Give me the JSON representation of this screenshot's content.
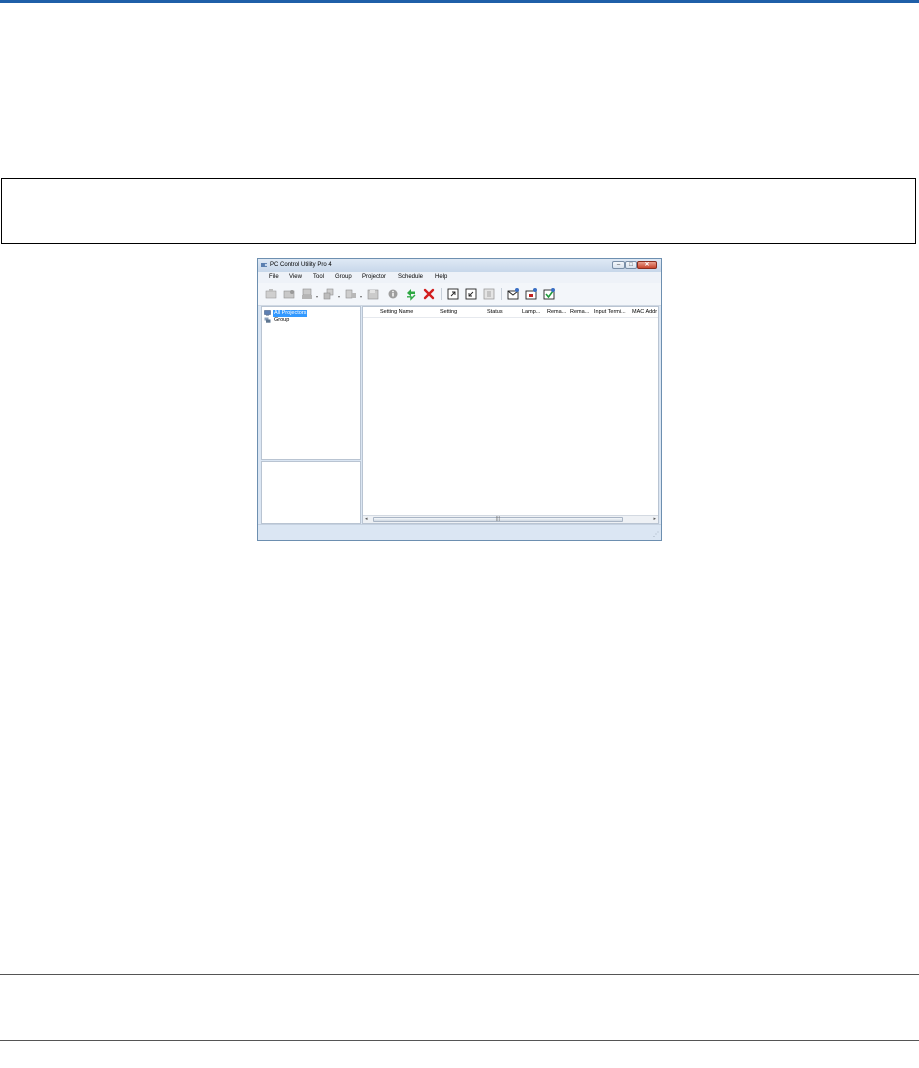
{
  "window": {
    "title": "PC Control Utility Pro 4",
    "controls": {
      "minimize": "–",
      "maximize": "□",
      "close": "✕"
    }
  },
  "menu": {
    "items": [
      "File",
      "View",
      "Tool",
      "Group",
      "Projector",
      "Schedule",
      "Help"
    ]
  },
  "toolbar": {
    "icons": [
      "monitor-icon",
      "folder-icon",
      "projector-icon",
      "group-icon",
      "network-icon",
      "save-icon",
      "info-icon",
      "refresh-icon",
      "delete-icon",
      "export-icon",
      "import-icon",
      "page-icon",
      "mail-icon",
      "calendar-icon",
      "check-icon"
    ]
  },
  "tree": {
    "items": [
      {
        "label": "All Projectors",
        "selected": true
      },
      {
        "label": "Group",
        "selected": false
      }
    ]
  },
  "table": {
    "columns": [
      "Setting Name",
      "Setting",
      "Status",
      "Lamp...",
      "Rema...",
      "Rema...",
      "Input Termi...",
      "MAC Addr"
    ]
  },
  "scrollbar": {
    "left_arrow": "◂",
    "right_arrow": "▸",
    "grip": "|||"
  },
  "colors": {
    "accent_rule": "#1f5fa8",
    "selection": "#3399ff"
  }
}
